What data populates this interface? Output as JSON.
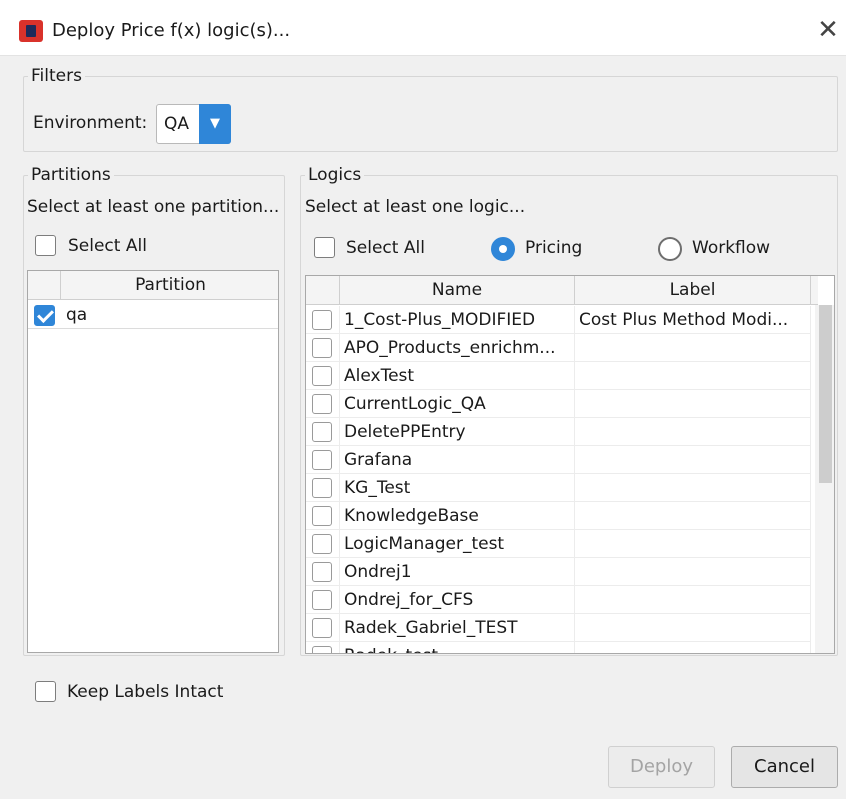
{
  "window": {
    "title": "Deploy Price f(x) logic(s)...",
    "app_icon": "app-logo-icon",
    "close_glyph": "✕"
  },
  "filters": {
    "legend": "Filters",
    "environment_label": "Environment:",
    "environment_value": "QA",
    "dropdown_glyph": "▼"
  },
  "partitions": {
    "legend": "Partitions",
    "hint": "Select at least one partition...",
    "select_all_label": "Select All",
    "select_all_checked": false,
    "column": "Partition",
    "rows": [
      {
        "name": "qa",
        "checked": true
      }
    ]
  },
  "logics": {
    "legend": "Logics",
    "hint": "Select at least one logic...",
    "select_all_label": "Select All",
    "select_all_checked": false,
    "radio_pricing_label": "Pricing",
    "radio_workflow_label": "Workflow",
    "selected_type": "Pricing",
    "columns": [
      "Name",
      "Label"
    ],
    "rows": [
      {
        "name": "1_Cost-Plus_MODIFIED",
        "label": "Cost Plus Method Modi...",
        "checked": false
      },
      {
        "name": "APO_Products_enrichm...",
        "label": "",
        "checked": false
      },
      {
        "name": "AlexTest",
        "label": "",
        "checked": false
      },
      {
        "name": "CurrentLogic_QA",
        "label": "",
        "checked": false
      },
      {
        "name": "DeletePPEntry",
        "label": "",
        "checked": false
      },
      {
        "name": "Grafana",
        "label": "",
        "checked": false
      },
      {
        "name": "KG_Test",
        "label": "",
        "checked": false
      },
      {
        "name": "KnowledgeBase",
        "label": "",
        "checked": false
      },
      {
        "name": "LogicManager_test",
        "label": "",
        "checked": false
      },
      {
        "name": "Ondrej1",
        "label": "",
        "checked": false
      },
      {
        "name": "Ondrej_for_CFS",
        "label": "",
        "checked": false
      },
      {
        "name": "Radek_Gabriel_TEST",
        "label": "",
        "checked": false
      },
      {
        "name": "Radek_test",
        "label": "",
        "checked": false
      }
    ]
  },
  "options": {
    "keep_labels_label": "Keep Labels Intact",
    "keep_labels_checked": false
  },
  "buttons": {
    "deploy_label": "Deploy",
    "deploy_enabled": false,
    "cancel_label": "Cancel"
  },
  "colors": {
    "accent": "#2f86d8",
    "background": "#f0f0f0",
    "titlebar": "#ffffff"
  }
}
